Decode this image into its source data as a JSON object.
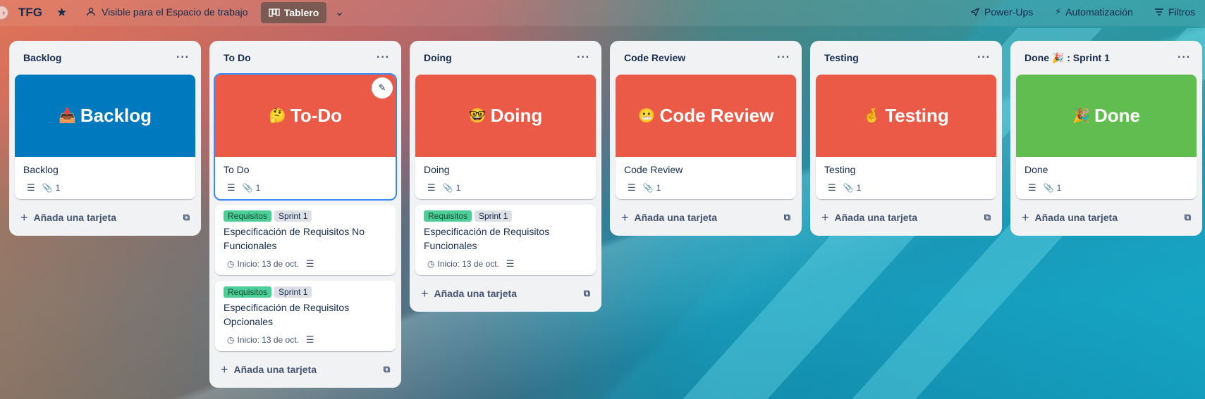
{
  "header": {
    "collapse_icon": "chevron-right-icon",
    "board_title": "TFG",
    "visibility": "Visible para el Espacio de trabajo",
    "view_label": "Tablero",
    "powerups": "Power-Ups",
    "automation": "Automatización",
    "filters": "Filtros"
  },
  "colors": {
    "blue": "#0079bf",
    "red": "#eb5a46",
    "green": "#61bd4f",
    "label_green": "#4bce97"
  },
  "add_card_label": "Añada una tarjeta",
  "lists": [
    {
      "title": "Backlog",
      "cover_text": "Backlog",
      "cover_emoji": "📥",
      "card_title": "Backlog",
      "attachments": "1"
    },
    {
      "title": "To Do",
      "cover_text": "To-Do",
      "cover_emoji": "🤔",
      "card_title": "To Do",
      "attachments": "1",
      "extra_cards": [
        {
          "labels": [
            "Requisitos",
            "Sprint 1"
          ],
          "title": "Especificación de Requisitos No Funcionales",
          "date": "Inicio: 13 de oct."
        },
        {
          "labels": [
            "Requisitos",
            "Sprint 1"
          ],
          "title": "Especificación de Requisitos Opcionales",
          "date": "Inicio: 13 de oct."
        }
      ]
    },
    {
      "title": "Doing",
      "cover_text": "Doing",
      "cover_emoji": "🤓",
      "card_title": "Doing",
      "attachments": "1",
      "extra_cards": [
        {
          "labels": [
            "Requisitos",
            "Sprint 1"
          ],
          "title": "Especificación de Requisitos Funcionales",
          "date": "Inicio: 13 de oct."
        }
      ]
    },
    {
      "title": "Code Review",
      "cover_text": "Code Review",
      "cover_emoji": "😬",
      "card_title": "Code Review",
      "attachments": "1"
    },
    {
      "title": "Testing",
      "cover_text": "Testing",
      "cover_emoji": "🤞",
      "card_title": "Testing",
      "attachments": "1"
    },
    {
      "title": "Done 🎉 : Sprint 1",
      "cover_text": "Done",
      "cover_emoji": "🎉",
      "card_title": "Done",
      "attachments": "1"
    }
  ]
}
